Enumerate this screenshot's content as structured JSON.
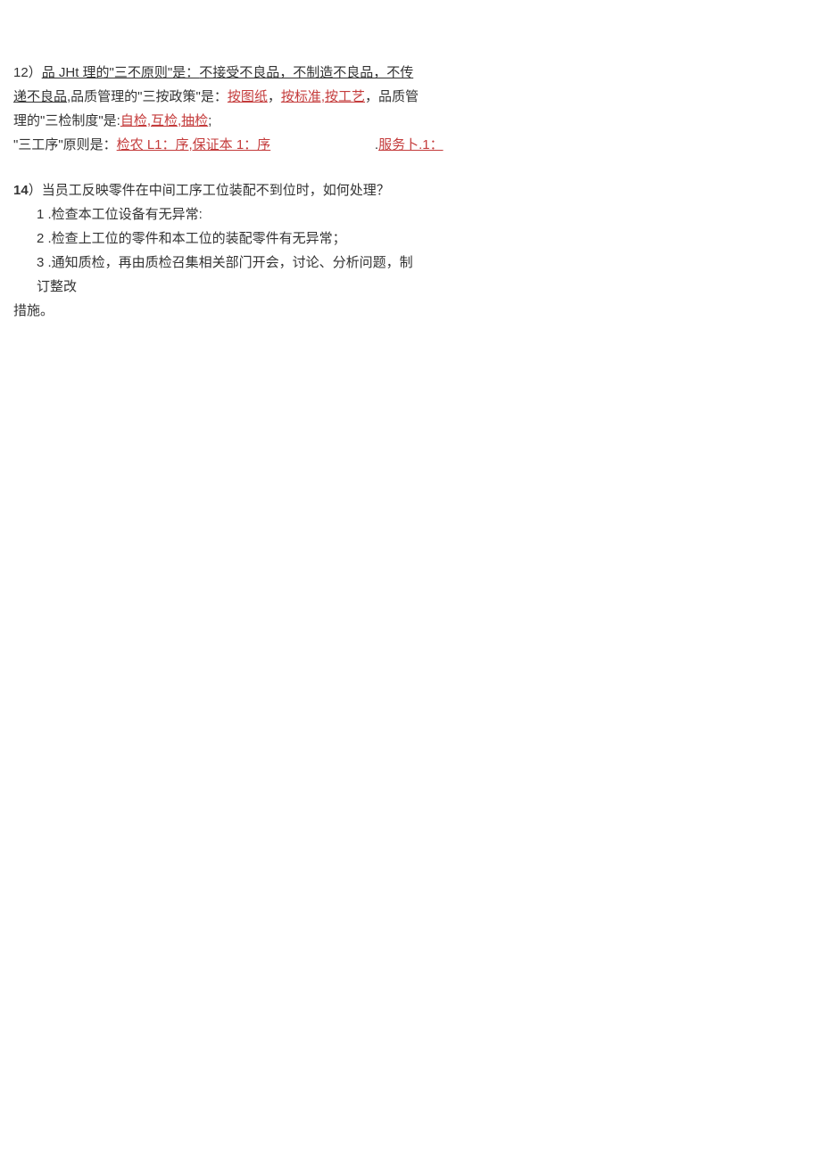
{
  "q12": {
    "t1": "12）",
    "t2": "品 JHt 理的\"三不原则\"是：",
    "t3": "不接受不良品，不制造不良品，不传递不良品",
    "t4": ",品质管理的\"三按政策\"是：",
    "t5": "按图纸",
    "t6": "，",
    "t7": "按标准,按工艺",
    "t8": "，品质管理的\"三检制度\"是:",
    "t9": "自检,互检,抽检",
    "t10": ";",
    "t11": "\"三工序\"原则是：",
    "t12": "检农 L1：序,保证本 1：序",
    "gap": "                            ",
    "t13": ".",
    "t14": "服务卜.1："
  },
  "q14": {
    "heading_lead": "14",
    "heading_rest": "）当员工反映零件在中间工序工位装配不到位时，如何处理？",
    "items": [
      "1   .检查本工位设备有无异常:",
      "2   .检查上工位的零件和本工位的装配零件有无异常；",
      "3   .通知质检，再由质检召集相关部门开会，讨论、分析问题，制订整改"
    ],
    "last": "措施。"
  }
}
